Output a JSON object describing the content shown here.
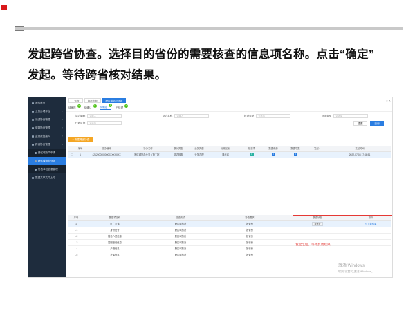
{
  "headline": {
    "line1": "发起跨省协查。选择目的省份的需要核查的信息项名称。点击“确定”",
    "line2": "发起。等待跨省核对结果。"
  },
  "sidebar": {
    "items": [
      {
        "label": "我的首页",
        "arrow": ""
      },
      {
        "label": "业务办理平台",
        "arrow": "∨"
      },
      {
        "label": "流调协查管理",
        "arrow": "∨"
      },
      {
        "label": "健康协查管理",
        "arrow": "∨"
      },
      {
        "label": "监测数据接入",
        "arrow": "∨"
      },
      {
        "label": "跨省协查管理",
        "arrow": "∧"
      }
    ],
    "subitems": [
      {
        "label": "跨区域协同申请",
        "active": false
      },
      {
        "label": "跨区域协办业务",
        "active": true
      },
      {
        "label": "协查单位信息管理",
        "active": false
      }
    ],
    "last": {
      "label": "数据共享文件上传"
    }
  },
  "topbar": {
    "tabs": [
      "工作台",
      "协办查询",
      "跨区域协办业务"
    ],
    "window_controls": "○  ✕"
  },
  "subtabs": [
    {
      "label": "待审核",
      "badge": "0"
    },
    {
      "label": "待确认",
      "badge": "0"
    },
    {
      "label": "待确定",
      "badge": "0"
    },
    {
      "label": "已处理",
      "badge": "0"
    }
  ],
  "filters": {
    "f1_label": "协办编码",
    "f1_placeholder": "请输入",
    "f2_label": "协办名称",
    "f2_placeholder": "请输入",
    "f3_label": "核对类型",
    "f3_placeholder": "请选择",
    "f4_label": "业务类型",
    "f4_placeholder": "请选择",
    "f5_label": "行政区划",
    "f5_placeholder": "请选择",
    "reset": "重置",
    "search": "查询",
    "add": "+ 新建跨省协查"
  },
  "upper_table": {
    "headers": [
      "",
      "序号",
      "协办编码",
      "协办名称",
      "核对类型",
      "业务类型",
      "行政区划",
      "核查项",
      "数据来源",
      "数据项数",
      "发起人",
      "发起时间"
    ],
    "rows": [
      [
        "",
        "1",
        "42120000000000XXXXXXX",
        "跨区域协办业务（第二批）",
        "协办核查",
        "业务办理",
        "湖北省",
        "0",
        "0",
        "0",
        "",
        "2022-07-08 17:46:51"
      ]
    ]
  },
  "lower_table": {
    "headers": [
      "序号",
      "数据项名称",
      "协查方式",
      "协查要求",
      "核查状态",
      "操作"
    ],
    "rows": [
      {
        "no": "1",
        "name": "广东省",
        "mode": "跨区域核对",
        "req": "按省份",
        "status": "待协查",
        "op": "下载结果"
      },
      {
        "no": "1.1",
        "name": "身份证号",
        "mode": "跨区域核对",
        "req": "按省份",
        "status": "",
        "op": ""
      },
      {
        "no": "1.2",
        "name": "姓名人员信息",
        "mode": "跨区域核对",
        "req": "按省份",
        "status": "",
        "op": ""
      },
      {
        "no": "1.3",
        "name": "婚姻登记信息",
        "mode": "跨区域核对",
        "req": "按省份",
        "status": "",
        "op": ""
      },
      {
        "no": "1.4",
        "name": "户籍信息",
        "mode": "跨区域核对",
        "req": "按省份",
        "status": "",
        "op": ""
      },
      {
        "no": "1.5",
        "name": "社保信息",
        "mode": "跨区域核对",
        "req": "按省份",
        "status": "",
        "op": ""
      }
    ]
  },
  "annotation": {
    "hint": "发起之后，等待反馈结果"
  },
  "watermark": {
    "line1": "激活 Windows",
    "line2": "转到“设置”以激活 Windows。"
  },
  "colors": {
    "accent": "#2a7de1",
    "sidebar": "#1e2c3d",
    "highlight": "#e53935",
    "corner": "#d9181b"
  }
}
